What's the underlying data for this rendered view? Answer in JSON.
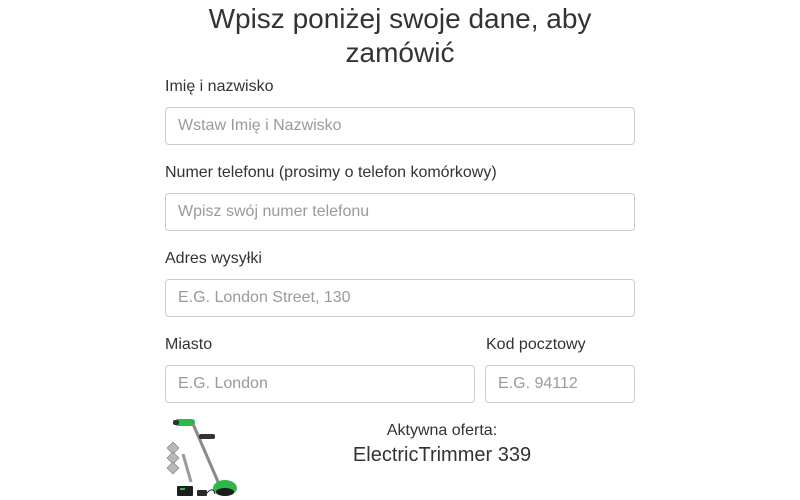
{
  "form": {
    "title": "Wpisz poniżej swoje dane, aby zamówić",
    "fields": {
      "name": {
        "label": "Imię i nazwisko",
        "placeholder": "Wstaw Imię i Nazwisko",
        "value": ""
      },
      "phone": {
        "label": "Numer telefonu (prosimy o telefon komórkowy)",
        "placeholder": "Wpisz swój numer telefonu",
        "value": ""
      },
      "address": {
        "label": "Adres wysyłki",
        "placeholder": "E.G. London Street, 130",
        "value": ""
      },
      "city": {
        "label": "Miasto",
        "placeholder": "E.G. London",
        "value": ""
      },
      "postcode": {
        "label": "Kod pocztowy",
        "placeholder": "E.G. 94112",
        "value": ""
      }
    }
  },
  "offer": {
    "label": "Aktywna oferta:",
    "product": "ElectricTrimmer 339",
    "image_icon": "trimmer-product-image"
  },
  "colors": {
    "text": "#333333",
    "placeholder": "#9a9a9a",
    "input_border": "#cccccc",
    "product_accent": "#2eb84a"
  }
}
